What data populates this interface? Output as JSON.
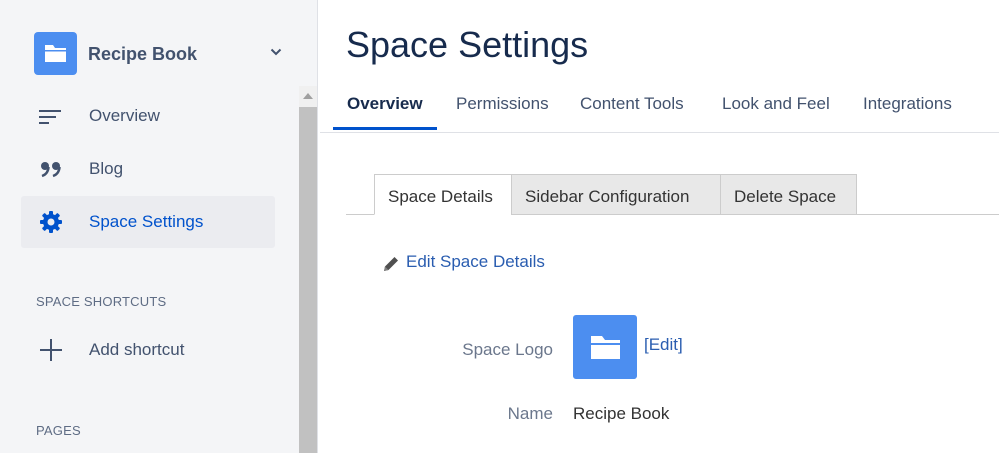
{
  "sidebar": {
    "space_name": "Recipe Book",
    "nav": [
      {
        "label": "Overview",
        "icon": "overview-lines-icon"
      },
      {
        "label": "Blog",
        "icon": "quote-icon"
      },
      {
        "label": "Space Settings",
        "icon": "gear-icon",
        "active": true
      }
    ],
    "shortcuts_title": "SPACE SHORTCUTS",
    "add_shortcut": "Add shortcut",
    "pages_title": "PAGES"
  },
  "main": {
    "title": "Space Settings",
    "tabs": [
      {
        "label": "Overview",
        "active": true
      },
      {
        "label": "Permissions"
      },
      {
        "label": "Content Tools"
      },
      {
        "label": "Look and Feel"
      },
      {
        "label": "Integrations"
      }
    ],
    "subtabs": [
      {
        "label": "Space Details",
        "active": true
      },
      {
        "label": "Sidebar Configuration"
      },
      {
        "label": "Delete Space"
      }
    ],
    "edit_link": "Edit Space Details",
    "fields": {
      "logo_label": "Space Logo",
      "logo_edit": "[Edit]",
      "name_label": "Name",
      "name_value": "Recipe Book"
    }
  },
  "colors": {
    "accent": "#0052cc",
    "logo_blue": "#4c8ef0",
    "link": "#2a5db0"
  }
}
